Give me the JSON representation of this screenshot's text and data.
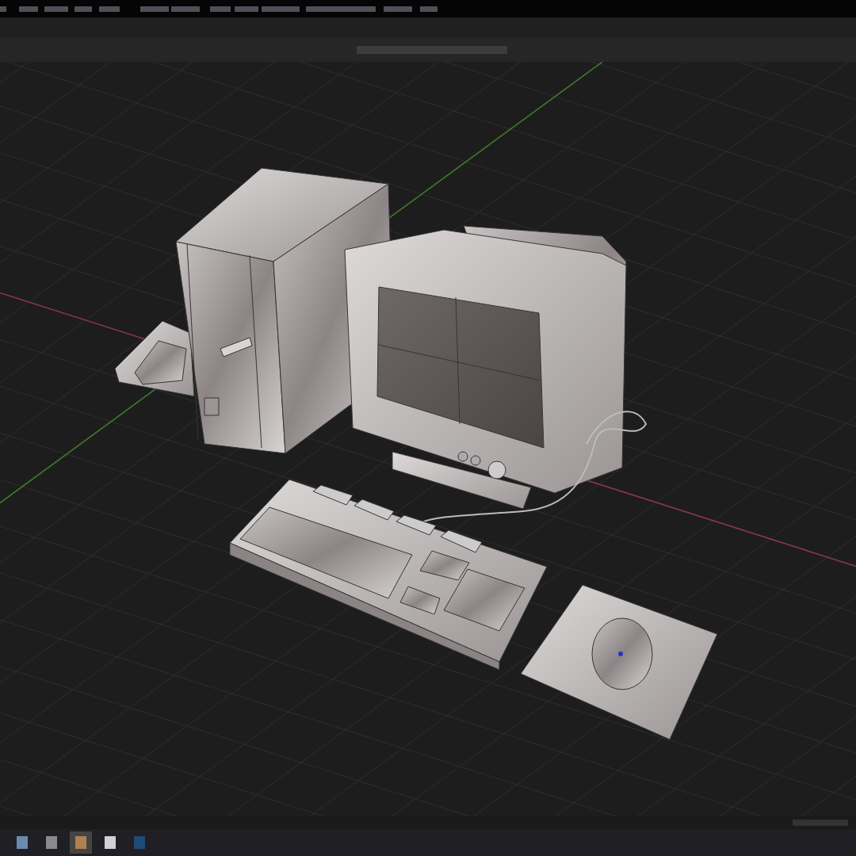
{
  "viewport": {
    "grid": true,
    "axes": [
      {
        "kind": "x",
        "color": "#8a3550"
      },
      {
        "kind": "y",
        "color": "#3f7a2a"
      }
    ]
  },
  "taskbar": {
    "apps": [
      {
        "color": "#6a8ab0",
        "selected": false
      },
      {
        "color": "#8a8a8a",
        "selected": false
      },
      {
        "color": "#b08050",
        "selected": true
      },
      {
        "color": "#d0d0d8",
        "selected": false
      },
      {
        "color": "#1e4a78",
        "selected": false
      }
    ]
  }
}
